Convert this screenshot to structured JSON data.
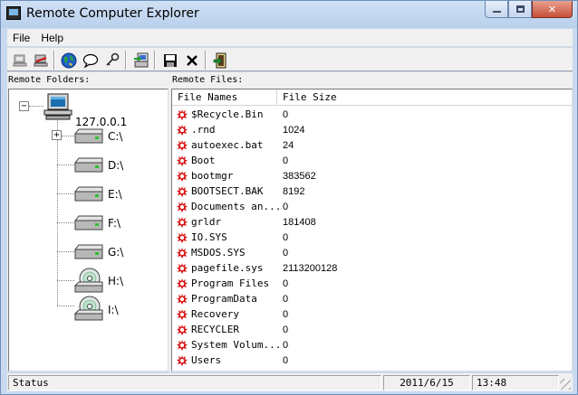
{
  "window": {
    "title": "Remote Computer Explorer",
    "caption_buttons": {
      "minimize": "▭",
      "maximize": "□",
      "close": "✕"
    }
  },
  "menu": {
    "items": [
      "File",
      "Help"
    ]
  },
  "toolbar": {
    "buttons": [
      {
        "icon": "disconnected-computer-icon"
      },
      {
        "icon": "disconnect-icon"
      },
      {
        "icon": "globe-icon"
      },
      {
        "icon": "chat-bubble-icon"
      },
      {
        "icon": "key-icon"
      },
      {
        "icon": "remote-desktop-icon"
      },
      {
        "icon": "save-icon"
      },
      {
        "icon": "delete-icon"
      },
      {
        "icon": "exit-icon"
      }
    ]
  },
  "left_pane": {
    "label": "Remote Folders:",
    "root": {
      "label": "127.0.0.1",
      "expander": "−",
      "icon": "computer-icon"
    },
    "drives": [
      {
        "label": "C:\\",
        "expander": "+",
        "icon": "hard-drive-icon"
      },
      {
        "label": "D:\\",
        "icon": "hard-drive-icon"
      },
      {
        "label": "E:\\",
        "icon": "hard-drive-icon"
      },
      {
        "label": "F:\\",
        "icon": "hard-drive-icon"
      },
      {
        "label": "G:\\",
        "icon": "hard-drive-icon"
      },
      {
        "label": "H:\\",
        "icon": "cd-drive-icon"
      },
      {
        "label": "I:\\",
        "icon": "cd-drive-icon"
      }
    ]
  },
  "right_pane": {
    "label": "Remote Files:",
    "columns": [
      "File Names",
      "File Size"
    ],
    "rows": [
      {
        "name": "$Recycle.Bin",
        "size": "0"
      },
      {
        "name": ".rnd",
        "size": "1024"
      },
      {
        "name": "autoexec.bat",
        "size": "24"
      },
      {
        "name": "Boot",
        "size": "0"
      },
      {
        "name": "bootmgr",
        "size": "383562"
      },
      {
        "name": "BOOTSECT.BAK",
        "size": "8192"
      },
      {
        "name": "Documents an...",
        "size": "0"
      },
      {
        "name": "grldr",
        "size": "181408"
      },
      {
        "name": "IO.SYS",
        "size": "0"
      },
      {
        "name": "MSDOS.SYS",
        "size": "0"
      },
      {
        "name": "pagefile.sys",
        "size": "2113200128"
      },
      {
        "name": "Program Files",
        "size": "0"
      },
      {
        "name": "ProgramData",
        "size": "0"
      },
      {
        "name": "Recovery",
        "size": "0"
      },
      {
        "name": "RECYCLER",
        "size": "0"
      },
      {
        "name": "System Volum...",
        "size": "0"
      },
      {
        "name": "Users",
        "size": "0"
      }
    ],
    "row_icon": "red-file-icon"
  },
  "statusbar": {
    "status": "Status",
    "date": "2011/6/15",
    "time": "13:48"
  },
  "colors": {
    "frame": "#c9daf0",
    "close_button": "#c64f38",
    "file_icon": "#d81010"
  }
}
